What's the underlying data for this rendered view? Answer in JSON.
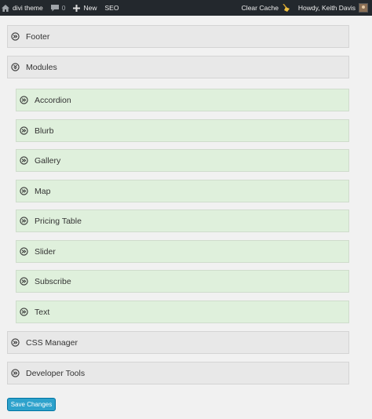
{
  "adminbar": {
    "site_name": "divi theme",
    "comment_count": "0",
    "new_label": "New",
    "seo_label": "SEO",
    "clear_cache_label": "Clear Cache",
    "howdy_label": "Howdy, Keith Davis"
  },
  "panels": {
    "footer": "Footer",
    "modules": "Modules",
    "modules_items": [
      "Accordion",
      "Blurb",
      "Gallery",
      "Map",
      "Pricing Table",
      "Slider",
      "Subscribe",
      "Text"
    ],
    "css_manager": "CSS Manager",
    "developer_tools": "Developer Tools"
  },
  "save_button": "Save Changes",
  "colors": {
    "adminbar_bg": "#23282d",
    "panel_bg": "#e8e8e8",
    "sub_panel_bg": "#dff0dc",
    "accent": "#2ea2cc"
  }
}
